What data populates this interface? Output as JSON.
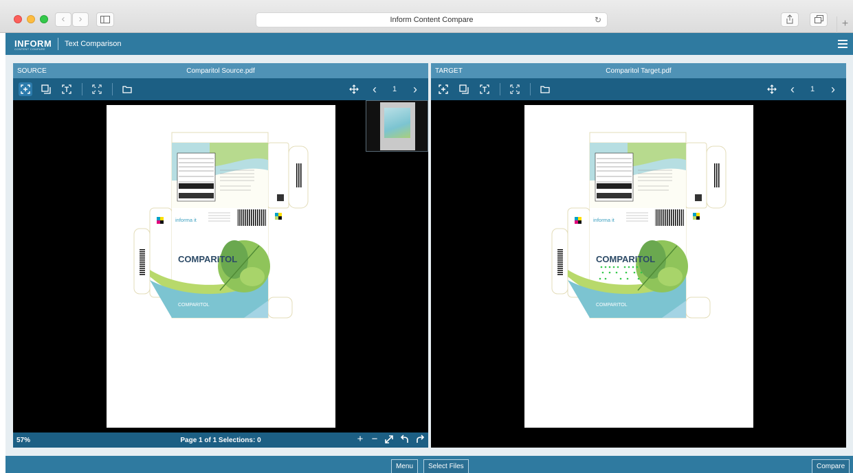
{
  "browser": {
    "title": "Inform Content Compare",
    "back_icon": "chevron-left-icon",
    "forward_icon": "chevron-right-icon"
  },
  "app": {
    "logo_text": "INFORM",
    "logo_subtext": "CONTENT COMPARE",
    "title": "Text Comparison"
  },
  "source": {
    "label": "SOURCE",
    "file_name": "Comparitol Source.pdf",
    "page_number": "1",
    "zoom": "57%",
    "page_info": "Page 1 of 1 Selections: 0"
  },
  "target": {
    "label": "TARGET",
    "file_name": "Comparitol Target.pdf",
    "page_number": "1"
  },
  "artwork": {
    "brand": "COMPARITOL",
    "logo": "informa it",
    "colors": {
      "teal": "#6fbfcf",
      "lime": "#b8d96b",
      "leaf_green": "#6aa84f",
      "navy_text": "#2c4a66",
      "diff_highlight": "#34c84a"
    }
  },
  "bottom": {
    "menu_label": "Menu",
    "select_files_label": "Select Files",
    "compare_label": "Compare"
  },
  "theme": {
    "header_blue": "#2f7aa0",
    "toolbar_blue": "#1c5f84",
    "title_blue": "#4f92b6"
  }
}
